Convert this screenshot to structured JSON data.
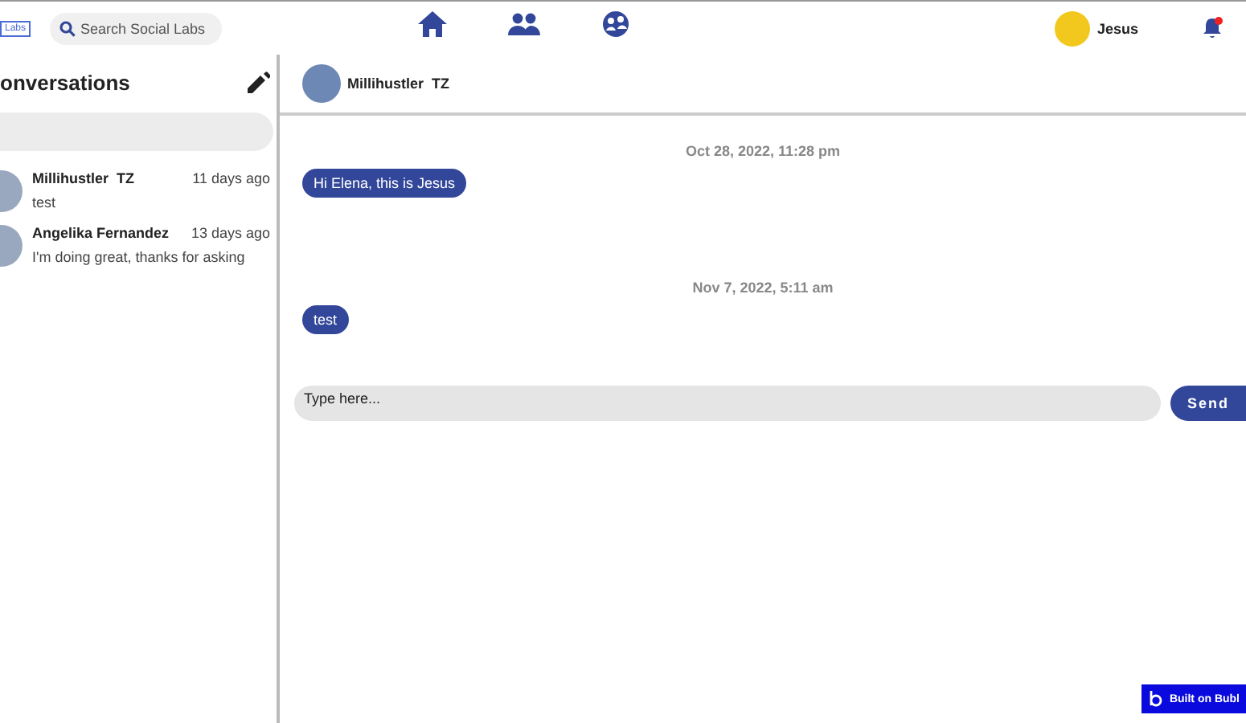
{
  "header": {
    "logo": "Labs",
    "search": {
      "placeholder": "Search Social Labs"
    },
    "nav": [
      {
        "kind": "home",
        "selected": false
      },
      {
        "kind": "people",
        "selected": false
      },
      {
        "kind": "groups",
        "selected": false
      }
    ],
    "user": {
      "name": "Jesus"
    },
    "notifications": {
      "unread": true
    }
  },
  "sidebar": {
    "title": "onversations",
    "conversations": [
      {
        "name": "Millihustler  TZ",
        "time": "11 days ago",
        "preview": "test",
        "selected": false
      },
      {
        "name": "Angelika Fernandez",
        "time": "13 days ago",
        "preview": "I'm doing great, thanks for asking",
        "selected": false
      }
    ]
  },
  "chat": {
    "contact": "Millihustler  TZ",
    "groups": [
      {
        "date": "Oct 28, 2022, 11:28 pm",
        "messages": [
          "Hi Elena, this is Jesus"
        ]
      },
      {
        "date": "Nov 7, 2022, 5:11 am",
        "messages": [
          "test"
        ]
      }
    ],
    "input": {
      "placeholder": "Type here..."
    },
    "send": "Send"
  },
  "badge": "Built on Bubl"
}
